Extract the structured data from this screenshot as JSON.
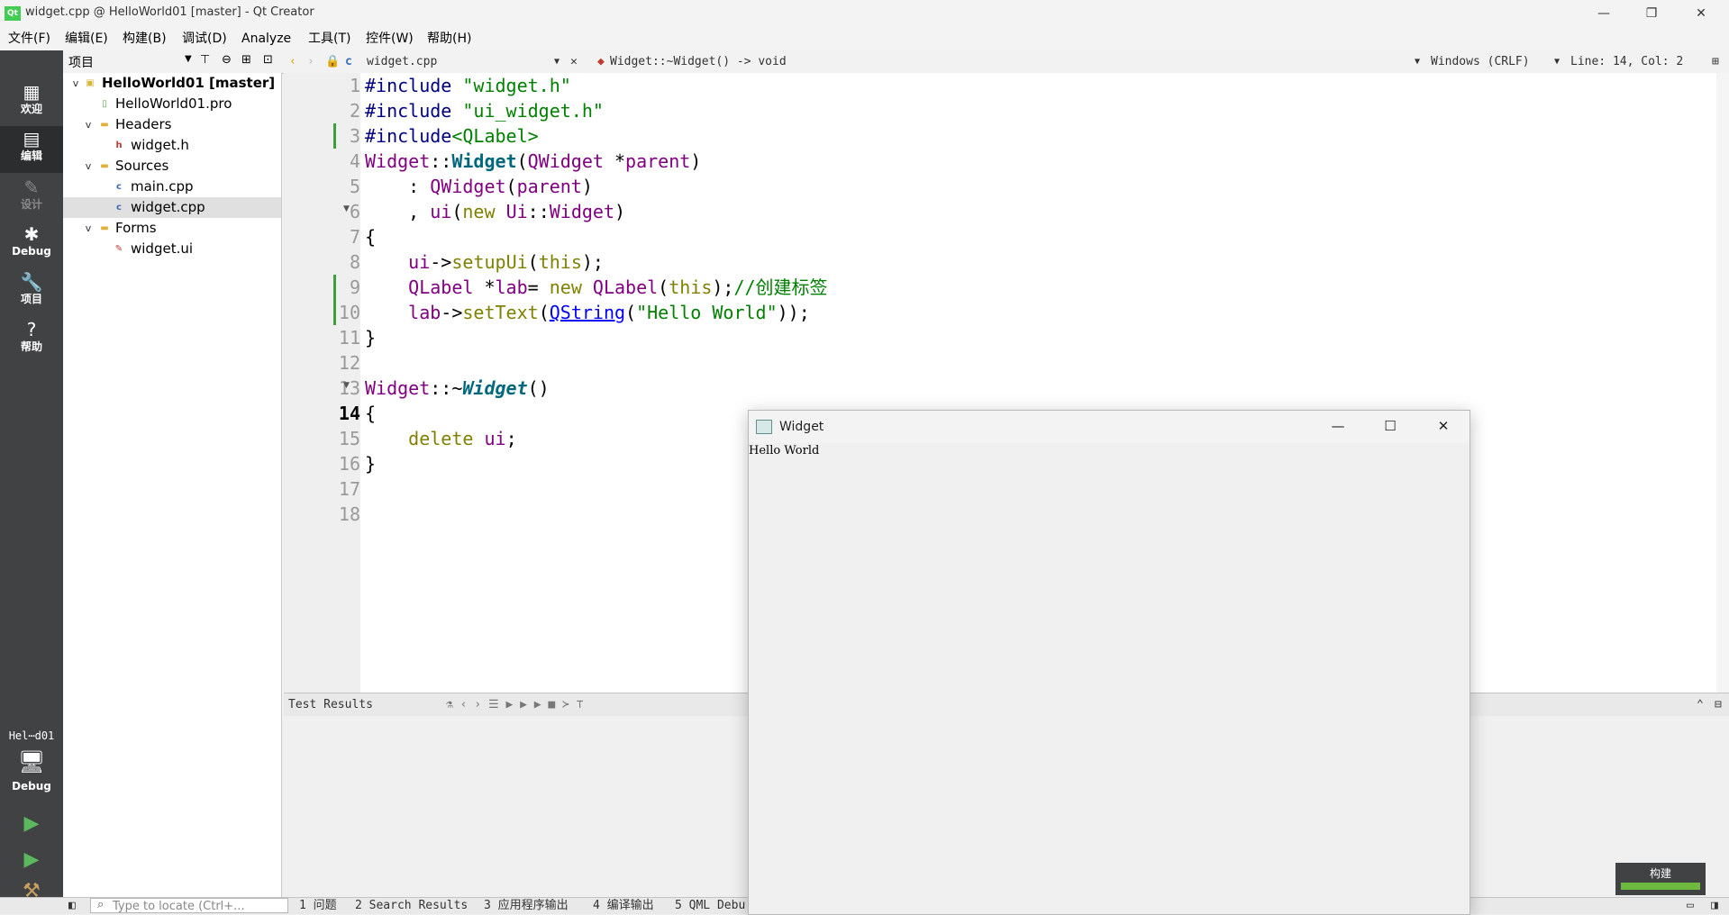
{
  "window": {
    "title": "widget.cpp @ HelloWorld01 [master] - Qt Creator",
    "logo_text": "Qt",
    "minimize": "—",
    "restore": "❐",
    "close": "✕"
  },
  "menu": [
    "文件(F)",
    "编辑(E)",
    "构建(B)",
    "调试(D)",
    "Analyze",
    "工具(T)",
    "控件(W)",
    "帮助(H)"
  ],
  "modes": [
    {
      "label": "欢迎",
      "icon": "▦"
    },
    {
      "label": "编辑",
      "icon": "▤"
    },
    {
      "label": "设计",
      "icon": "✎"
    },
    {
      "label": "Debug",
      "icon": "✱"
    },
    {
      "label": "项目",
      "icon": "🔧"
    },
    {
      "label": "帮助",
      "icon": "?"
    }
  ],
  "project_panel": {
    "title": "项目",
    "tree": [
      {
        "text": "HelloWorld01 [master]",
        "arrow": "v",
        "icon": "▣",
        "icon_color": "#d9b53a"
      },
      {
        "text": "HelloWorld01.pro",
        "arrow": "",
        "icon": "▯",
        "icon_color": "#5aa64a"
      },
      {
        "text": "Headers",
        "arrow": "v",
        "icon": "▬",
        "icon_color": "#e0b03a"
      },
      {
        "text": "widget.h",
        "arrow": "",
        "icon": "h",
        "icon_color": "#c0392b"
      },
      {
        "text": "Sources",
        "arrow": "v",
        "icon": "▬",
        "icon_color": "#e0b03a"
      },
      {
        "text": "main.cpp",
        "arrow": "",
        "icon": "c",
        "icon_color": "#3a6fb5"
      },
      {
        "text": "widget.cpp",
        "arrow": "",
        "icon": "c",
        "icon_color": "#3a6fb5"
      },
      {
        "text": "Forms",
        "arrow": "v",
        "icon": "▬",
        "icon_color": "#e0b03a"
      },
      {
        "text": "widget.ui",
        "arrow": "",
        "icon": "✎",
        "icon_color": "#c0392b"
      }
    ]
  },
  "editor_toolbar": {
    "file": "widget.cpp",
    "symbol": "Widget::~Widget() -> void",
    "line_ending": "Windows (CRLF)",
    "position": "Line: 14, Col: 2"
  },
  "editor": {
    "line_numbers": [
      "1",
      "2",
      "3",
      "4",
      "5",
      "6",
      "7",
      "8",
      "9",
      "10",
      "11",
      "12",
      "13",
      "14",
      "15",
      "16",
      "17",
      "18"
    ],
    "current_line": "14"
  },
  "output_pane": {
    "title": "Test Results"
  },
  "kit": {
    "project": "Hel⋯d01",
    "config": "Debug"
  },
  "build": {
    "label": "构建",
    "progress": 1.0
  },
  "statusbar": {
    "locate_placeholder": "Type to locate (Ctrl+...",
    "tabs": [
      "1 问题",
      "2 Search Results",
      "3 应用程序输出",
      "4 编译输出",
      "5 QML Debu"
    ]
  },
  "widget_window": {
    "title": "Widget",
    "label_text": "Hello World",
    "minimize": "—",
    "maximize": "☐",
    "close": "✕"
  },
  "colors": {
    "mode_bar": "#404244",
    "qt_green": "#41cd52"
  }
}
